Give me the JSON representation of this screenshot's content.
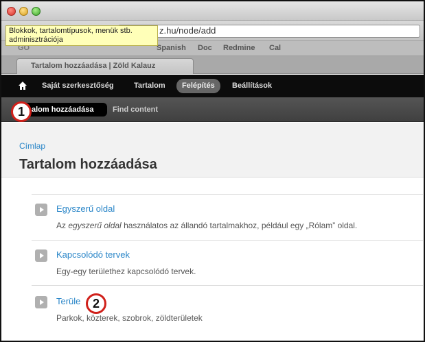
{
  "tooltip": {
    "line1": "Blokkok, tartalomtípusok, menük stb.",
    "line2": "adminisztrációja"
  },
  "address": {
    "url": "z.hu/node/add"
  },
  "bookmarks": [
    "Spanish",
    "Doc",
    "Redmine",
    "Cal"
  ],
  "tab": {
    "title": "Tartalom hozzáadása | Zöld Kalauz"
  },
  "toolbar": {
    "items": [
      "Saját szerkesztőség",
      "Tartalom",
      "Felépítés",
      "Beállítások"
    ],
    "active_index": 2
  },
  "shortcuts": {
    "active": "alom hozzáadása",
    "link": "Find content"
  },
  "markers": {
    "m1": "1",
    "m2": "2"
  },
  "breadcrumb": "Címlap",
  "page_title": "Tartalom hozzáadása",
  "content_types": [
    {
      "title": "Egyszerű oldal",
      "desc_before": "Az ",
      "desc_em": "egyszerű oldal",
      "desc_after": " használatos az állandó tartalmakhoz, például egy „Rólam” oldal."
    },
    {
      "title": "Kapcsolódó tervek",
      "desc": "Egy-egy területhez kapcsolódó tervek."
    },
    {
      "title": "Terüle",
      "desc": "Parkok, közterek, szobrok, zöldterületek"
    }
  ],
  "colors": {
    "link": "#2a86c8",
    "marker": "#d0201a",
    "toolbar": "#0c0c0c",
    "tooltip": "#ffffb8"
  }
}
